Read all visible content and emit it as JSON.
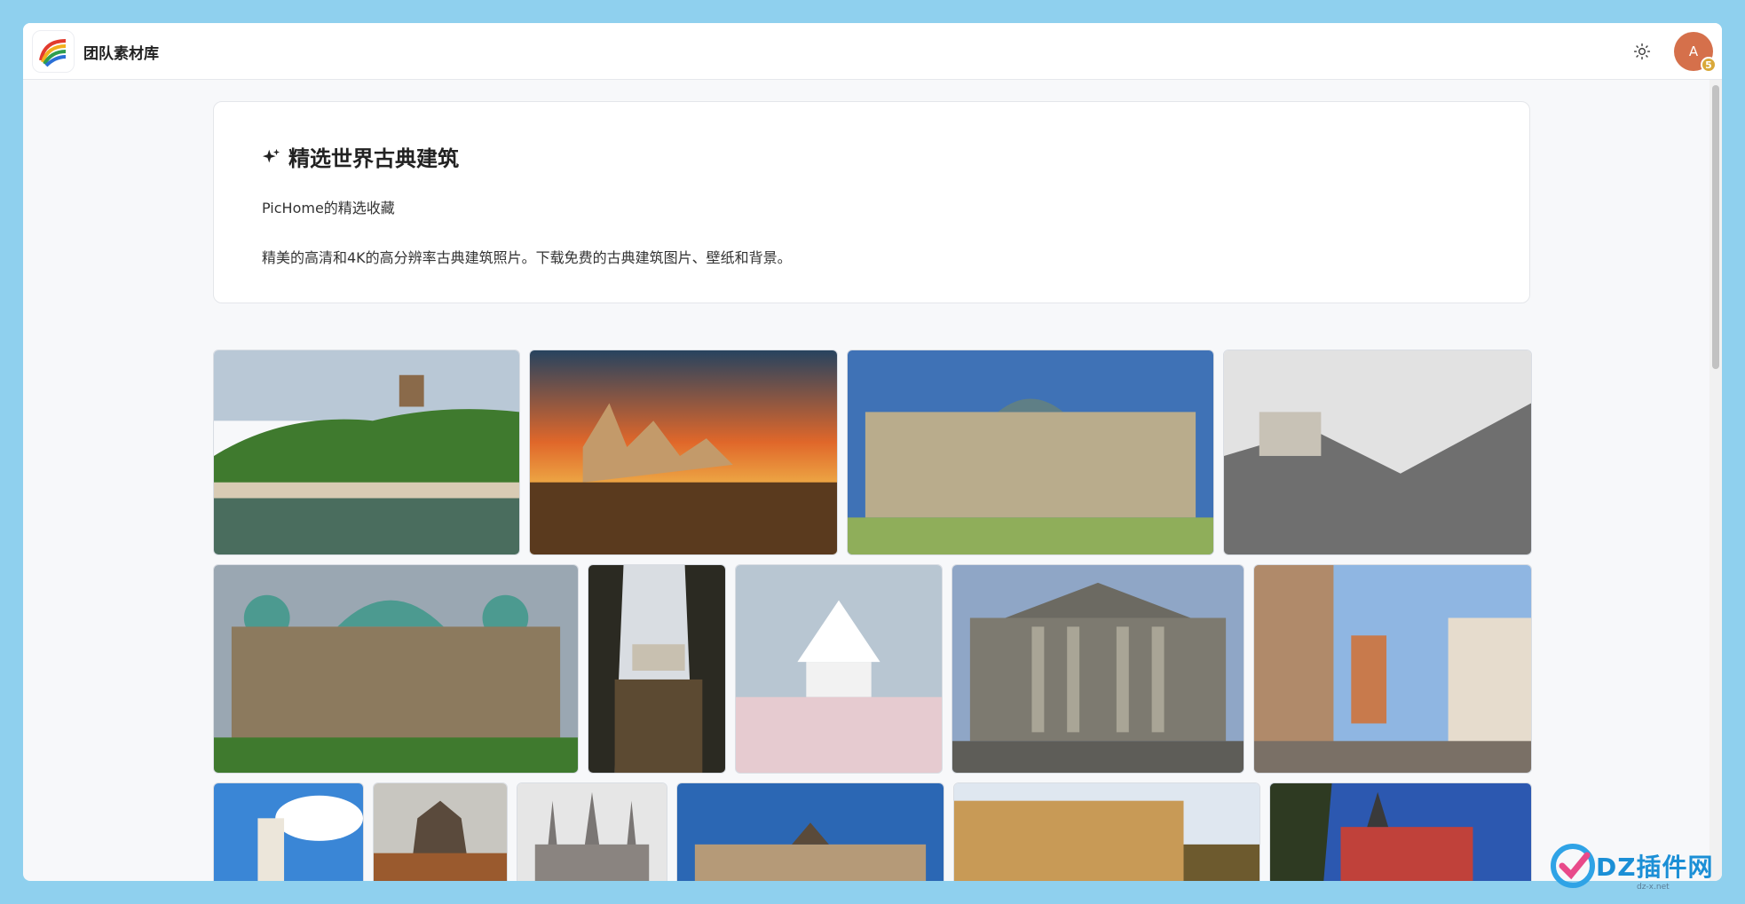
{
  "header": {
    "app_title": "团队素材库",
    "avatar_letter": "A",
    "avatar_badge": "5",
    "theme_icon": "sun-icon"
  },
  "hero": {
    "title": "精选世界古典建筑",
    "subtitle": "PicHome的精选收藏",
    "description": "精美的高清和4K的高分辨率古典建筑照片。下载免费的古典建筑图片、壁纸和背景。",
    "icon": "sparkle-icon"
  },
  "gallery": {
    "rows": [
      [
        "castle-hill-river",
        "castle-sunset",
        "reichstag-front",
        "snowy-castle"
      ],
      [
        "berlin-cathedral",
        "castle-forest",
        "japanese-castle",
        "reichstag-columns",
        "old-town-street"
      ],
      [
        "white-castle-clouds",
        "castle-autumn",
        "gothic-cathedral",
        "palace-blue-sky",
        "baroque-palace",
        "red-tower-building"
      ]
    ]
  },
  "watermark": {
    "text": "DZ插件网",
    "small": "dz-x.net"
  }
}
